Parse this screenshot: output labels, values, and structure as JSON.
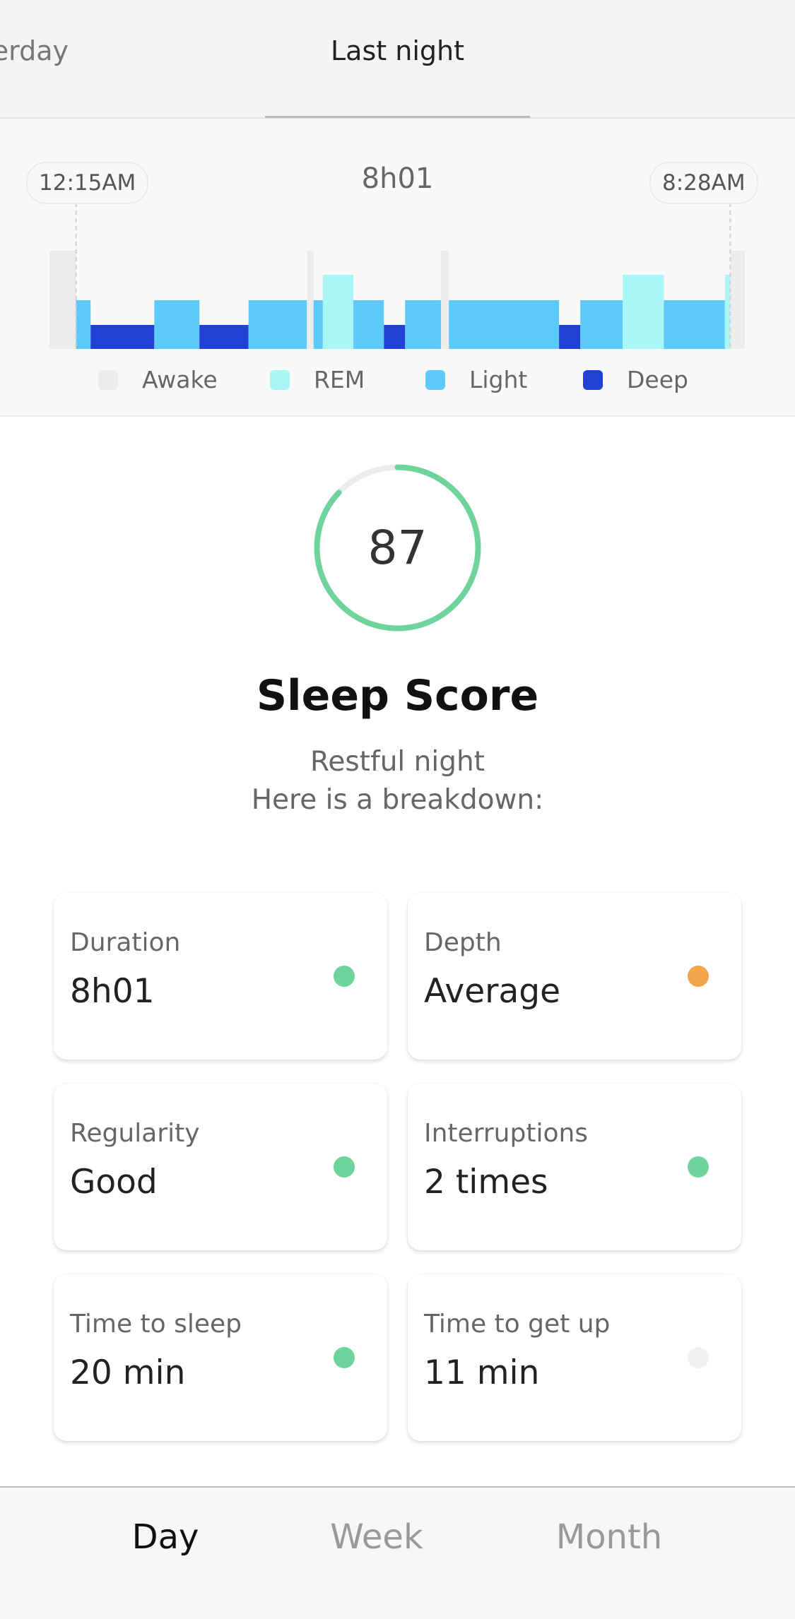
{
  "tabs": {
    "previous": "Yesterday",
    "previous_visible": "erday",
    "active": "Last night"
  },
  "chart_data": {
    "type": "sleep-stage-timeline",
    "duration_label": "8h01",
    "start_label": "12:15AM",
    "end_label": "8:28AM",
    "legend": [
      {
        "stage": "awake",
        "label": "Awake",
        "color": "#ececec"
      },
      {
        "stage": "rem",
        "label": "REM",
        "color": "#a8f6f6"
      },
      {
        "stage": "light",
        "label": "Light",
        "color": "#5ecafb"
      },
      {
        "stage": "deep",
        "label": "Deep",
        "color": "#2141d4"
      }
    ],
    "segments_minutes": [
      {
        "stage": "awake",
        "minutes": 20
      },
      {
        "stage": "light",
        "minutes": 11
      },
      {
        "stage": "deep",
        "minutes": 48
      },
      {
        "stage": "light",
        "minutes": 34
      },
      {
        "stage": "deep",
        "minutes": 37
      },
      {
        "stage": "light",
        "minutes": 44
      },
      {
        "stage": "awake",
        "minutes": 5
      },
      {
        "stage": "light",
        "minutes": 7
      },
      {
        "stage": "rem",
        "minutes": 23
      },
      {
        "stage": "light",
        "minutes": 23
      },
      {
        "stage": "deep",
        "minutes": 16
      },
      {
        "stage": "light",
        "minutes": 27
      },
      {
        "stage": "awake",
        "minutes": 6
      },
      {
        "stage": "light",
        "minutes": 83
      },
      {
        "stage": "deep",
        "minutes": 16
      },
      {
        "stage": "light",
        "minutes": 32
      },
      {
        "stage": "rem",
        "minutes": 31
      },
      {
        "stage": "light",
        "minutes": 46
      },
      {
        "stage": "rem",
        "minutes": 4
      },
      {
        "stage": "awake",
        "minutes": 11
      }
    ]
  },
  "score": {
    "value": "87",
    "percent": 87,
    "color": "#6fd49b",
    "track_color": "#ececec",
    "title": "Sleep Score",
    "subtitle": "Restful night",
    "subtitle2": "Here is a breakdown:"
  },
  "metrics": [
    {
      "label": "Duration",
      "value": "8h01",
      "status_color": "#6fd49b"
    },
    {
      "label": "Depth",
      "value": "Average",
      "status_color": "#f2a64a"
    },
    {
      "label": "Regularity",
      "value": "Good",
      "status_color": "#6fd49b"
    },
    {
      "label": "Interruptions",
      "value": "2 times",
      "status_color": "#6fd49b"
    },
    {
      "label": "Time to sleep",
      "value": "20 min",
      "status_color": "#6fd49b"
    },
    {
      "label": "Time to get up",
      "value": "11 min",
      "status_color": "#f1f1f1"
    }
  ],
  "bottom_nav": [
    {
      "label": "Day",
      "active": true
    },
    {
      "label": "Week",
      "active": false
    },
    {
      "label": "Month",
      "active": false
    }
  ]
}
